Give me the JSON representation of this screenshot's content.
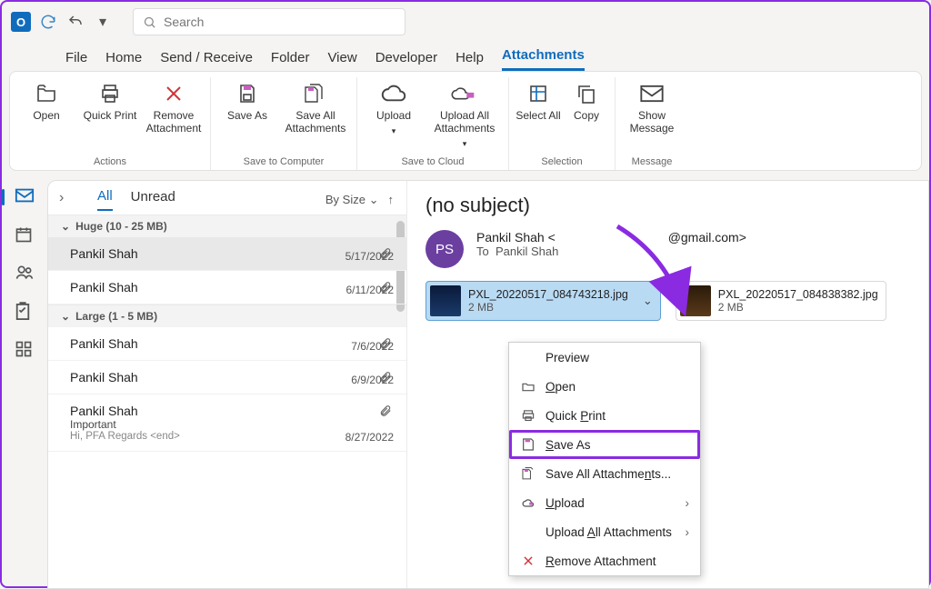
{
  "titlebar": {
    "search_placeholder": "Search"
  },
  "tabs": [
    "File",
    "Home",
    "Send / Receive",
    "Folder",
    "View",
    "Developer",
    "Help",
    "Attachments"
  ],
  "active_tab": "Attachments",
  "ribbon": {
    "groups": [
      {
        "label": "Actions",
        "buttons": [
          {
            "id": "open",
            "label": "Open"
          },
          {
            "id": "quickprint",
            "label": "Quick Print"
          },
          {
            "id": "remove",
            "label": "Remove Attachment"
          }
        ]
      },
      {
        "label": "Save to Computer",
        "buttons": [
          {
            "id": "saveas",
            "label": "Save As"
          },
          {
            "id": "saveall",
            "label": "Save All Attachments"
          }
        ]
      },
      {
        "label": "Save to Cloud",
        "buttons": [
          {
            "id": "upload",
            "label": "Upload"
          },
          {
            "id": "uploadall",
            "label": "Upload All Attachments"
          }
        ]
      },
      {
        "label": "Selection",
        "buttons": [
          {
            "id": "selectall",
            "label": "Select All"
          },
          {
            "id": "copy",
            "label": "Copy"
          }
        ]
      },
      {
        "label": "Message",
        "buttons": [
          {
            "id": "showmsg",
            "label": "Show Message"
          }
        ]
      }
    ]
  },
  "filters": {
    "all": "All",
    "unread": "Unread",
    "sort": "By Size"
  },
  "sections": [
    {
      "header": "Huge (10 - 25 MB)",
      "items": [
        {
          "from": "Pankil Shah",
          "date": "5/17/2022",
          "clip": true,
          "selected": true
        },
        {
          "from": "Pankil Shah",
          "date": "6/11/2022",
          "clip": true
        }
      ]
    },
    {
      "header": "Large (1 - 5 MB)",
      "items": [
        {
          "from": "Pankil Shah",
          "date": "7/6/2022",
          "clip": true
        },
        {
          "from": "Pankil Shah",
          "date": "6/9/2022",
          "clip": true
        },
        {
          "from": "Pankil Shah",
          "date": "8/27/2022",
          "clip": true,
          "subject": "Important",
          "preview": "Hi, PFA Regards <end>"
        }
      ]
    }
  ],
  "message": {
    "subject": "(no subject)",
    "avatar": "PS",
    "from_name": "Pankil Shah",
    "from_email_prefix": " < ",
    "from_email_suffix": "@gmail.com>",
    "to_label": "To",
    "to_name": "Pankil Shah",
    "attachments": [
      {
        "name": "PXL_20220517_084743218.jpg",
        "size": "2 MB",
        "selected": true
      },
      {
        "name": "PXL_20220517_084838382.jpg",
        "size": "2 MB",
        "selected": false
      }
    ]
  },
  "context_menu": [
    {
      "id": "preview",
      "label": "Preview",
      "icon": ""
    },
    {
      "id": "open",
      "label": "Open",
      "icon": "folder",
      "accel": "O"
    },
    {
      "id": "quickprint",
      "label": "Quick Print",
      "icon": "printer",
      "accel": "P"
    },
    {
      "id": "saveas",
      "label": "Save As",
      "icon": "disk",
      "accel": "S",
      "highlight": true
    },
    {
      "id": "saveall",
      "label": "Save All Attachments...",
      "icon": "disk-multi",
      "accel": "n"
    },
    {
      "id": "upload",
      "label": "Upload",
      "icon": "cloud",
      "accel": "U",
      "submenu": true
    },
    {
      "id": "uploadall",
      "label": "Upload All Attachments",
      "icon": "",
      "accel": "A",
      "submenu": true
    },
    {
      "id": "removeatt",
      "label": "Remove Attachment",
      "icon": "x",
      "accel": "R"
    }
  ]
}
